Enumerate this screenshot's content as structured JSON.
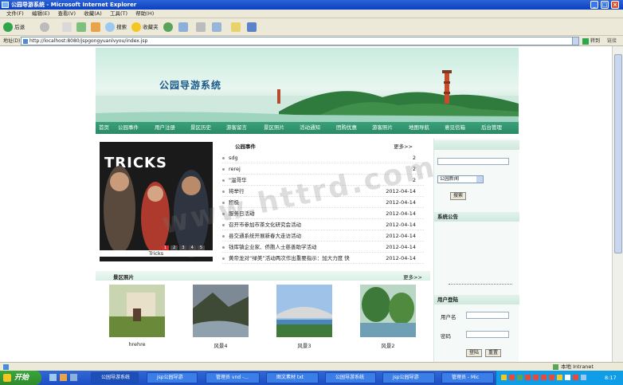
{
  "window": {
    "title": "公园导游系统 - Microsoft Internet Explorer"
  },
  "menu": [
    "文件(F)",
    "编辑(E)",
    "查看(V)",
    "收藏(A)",
    "工具(T)",
    "帮助(H)"
  ],
  "toolbar": {
    "back": "后退",
    "search": "搜索",
    "favorites": "收藏夹"
  },
  "address": {
    "label": "地址(D)",
    "url": "http://localhost:8080/jspgongyuanlvyou/index.jsp",
    "go": "转到",
    "links": "链接"
  },
  "site": {
    "title": "公园导游系统"
  },
  "nav": [
    "首页",
    "公园事件",
    "用户注册",
    "景区历史",
    "游客留言",
    "景区照片",
    "活动通知",
    "团购优惠",
    "游客照片",
    "地图导航",
    "意见信箱",
    "后台管理"
  ],
  "promo": {
    "title": "TRICKS",
    "caption": "Tricks",
    "pages": [
      "1",
      "2",
      "3",
      "4",
      "5"
    ]
  },
  "news": {
    "title": "公园事件",
    "more": "更多>>",
    "items": [
      {
        "title": "sdg",
        "date": "2"
      },
      {
        "title": "rerej",
        "date": "2"
      },
      {
        "title": "\"温哥华",
        "date": "2"
      },
      {
        "title": "将举行",
        "date": "2012-04-14"
      },
      {
        "title": "积极",
        "date": "2012-04-14"
      },
      {
        "title": "服务日活动",
        "date": "2012-04-14"
      },
      {
        "title": "召开市参加市茶文化研究会活动",
        "date": "2012-04-14"
      },
      {
        "title": "县交通系统开展新春大走访活动",
        "date": "2012-04-14"
      },
      {
        "title": "钱库镇企业家、侨胞人士慈善助学活动",
        "date": "2012-04-14"
      },
      {
        "title": "黄帝龙对“绿美”活动两次作出重要指示：加大力度 快",
        "date": "2012-04-14"
      }
    ]
  },
  "sidebar": {
    "search_head": "",
    "search_select": "公园新闻",
    "search_button": "搜索",
    "notice_head": "系统公告",
    "notice_text": "",
    "login_head": "用户登陆",
    "username_label": "用户名",
    "password_label": "密码",
    "login_button": "登陆",
    "reset_button": "重置"
  },
  "gallery": {
    "title": "景区照片",
    "more": "更多>>",
    "items": [
      {
        "caption": "hrehre"
      },
      {
        "caption": "风景4"
      },
      {
        "caption": "风景3"
      },
      {
        "caption": "风景2"
      }
    ]
  },
  "status": {
    "zone": "本地 Intranet"
  },
  "taskbar": {
    "start": "开始",
    "tasks": [
      "公园导游系统",
      "jsp公园导游",
      "管理员 vnd -...",
      "图文素材 txt",
      "公园导游系统",
      "jsp公园导游",
      "管理员 - Mic"
    ],
    "clock": "8:17"
  },
  "watermark": "www.httrd.com",
  "colors": {
    "nav": "#2b8a66",
    "title": "#1b5a8a",
    "ie_title": "#0b3fbf"
  }
}
